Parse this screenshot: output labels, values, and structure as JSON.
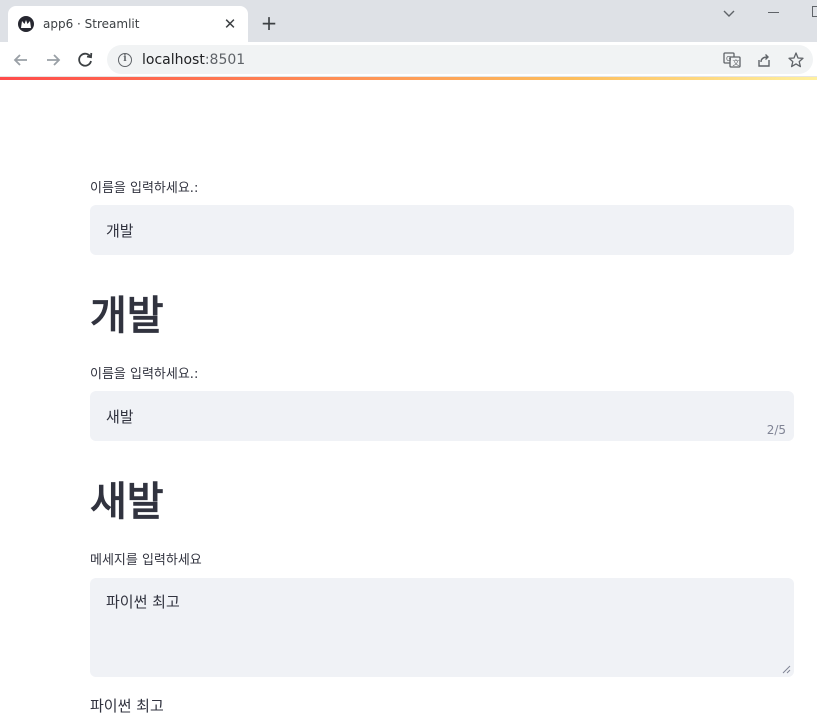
{
  "browser": {
    "tab_title": "app6 · Streamlit",
    "url_host": "localhost",
    "url_port": ":8501",
    "icons": [
      "streamlit-favicon",
      "close-icon",
      "plus-icon",
      "chevron-down-icon",
      "minimize-icon",
      "maximize-icon",
      "back-icon",
      "forward-icon",
      "reload-icon",
      "info-icon",
      "translate-icon",
      "share-icon",
      "star-icon"
    ]
  },
  "form": {
    "name_label_1": "이름을 입력하세요.:",
    "name_value_1": "개발",
    "name_heading_1": "개발",
    "name_label_2": "이름을 입력하세요.:",
    "name_value_2": "새발",
    "name_counter_2": "2/5",
    "name_heading_2": "새발",
    "message_label": "메세지를 입력하세요",
    "message_value": "파이썬 최고",
    "message_output": "파이썬 최고"
  },
  "colors": {
    "input_background": "#f0f2f6",
    "text": "#31333f",
    "accent_gradient_start": "#ff4b4b",
    "accent_gradient_end": "#fdbd5c"
  }
}
